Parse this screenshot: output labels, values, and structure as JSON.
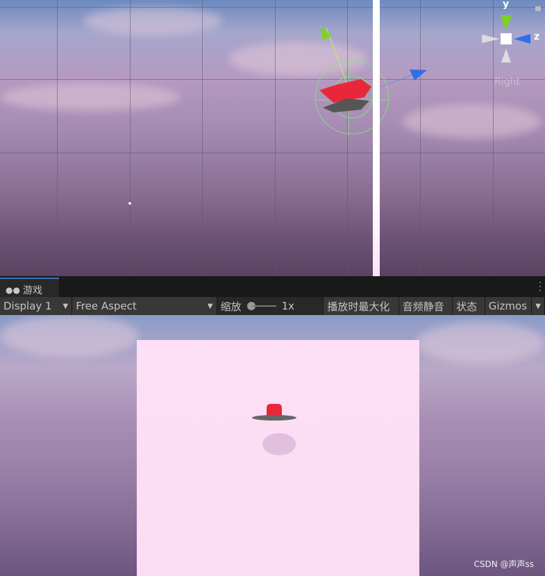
{
  "scene_view": {
    "gizmo": {
      "y_label": "y",
      "z_label": "z",
      "view_label": "Right"
    }
  },
  "game_tab": {
    "label": "游戏",
    "icon": "gamepad-icon"
  },
  "toolbar": {
    "display": "Display 1",
    "aspect": "Free Aspect",
    "scale_label": "缩放",
    "scale_value": "1x",
    "maximize_on_play": "播放时最大化",
    "mute_audio": "音频静音",
    "stats": "状态",
    "gizmos": "Gizmos"
  },
  "watermark": "CSDN @声声ss"
}
